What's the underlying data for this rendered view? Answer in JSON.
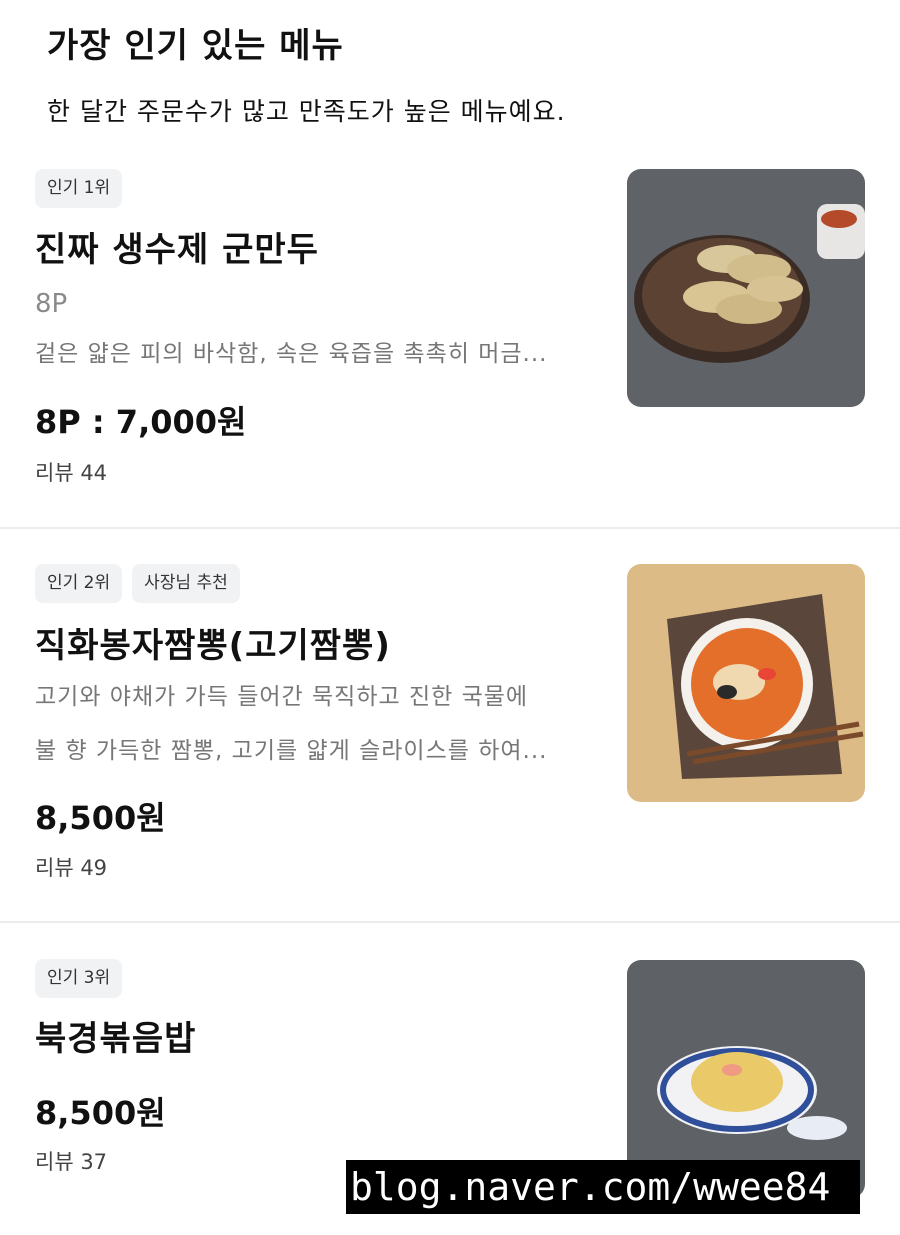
{
  "section": {
    "title": "가장 인기 있는 메뉴",
    "subtitle": "한 달간 주문수가 많고 만족도가 높은 메뉴예요."
  },
  "items": [
    {
      "badges": [
        "인기 1위"
      ],
      "name": "진짜 생수제 군만두",
      "option": "8P",
      "desc_lines": [
        "겉은 얇은 피의 바삭함, 속은 육즙을 촉촉히 머금..."
      ],
      "price": "8P : 7,000원",
      "review": "리뷰 44",
      "image_icon": "dumpling-plate-image"
    },
    {
      "badges": [
        "인기 2위",
        "사장님 추천"
      ],
      "name": "직화봉자짬뽕(고기짬뽕)",
      "desc_lines": [
        "고기와 야채가 가득 들어간 묵직하고 진한 국물에",
        "불 향 가득한 짬뽕, 고기를 얇게 슬라이스를 하여..."
      ],
      "price": "8,500원",
      "review": "리뷰 49",
      "image_icon": "jjamppong-bowl-image"
    },
    {
      "badges": [
        "인기 3위"
      ],
      "name": "북경볶음밥",
      "price": "8,500원",
      "review": "리뷰 37",
      "image_icon": "fried-rice-plate-image"
    }
  ],
  "watermark": "blog.naver.com/wwee84",
  "colors": {
    "badge_bg": "#f1f2f4",
    "desc_gray": "#777777",
    "divider": "#ececec"
  }
}
